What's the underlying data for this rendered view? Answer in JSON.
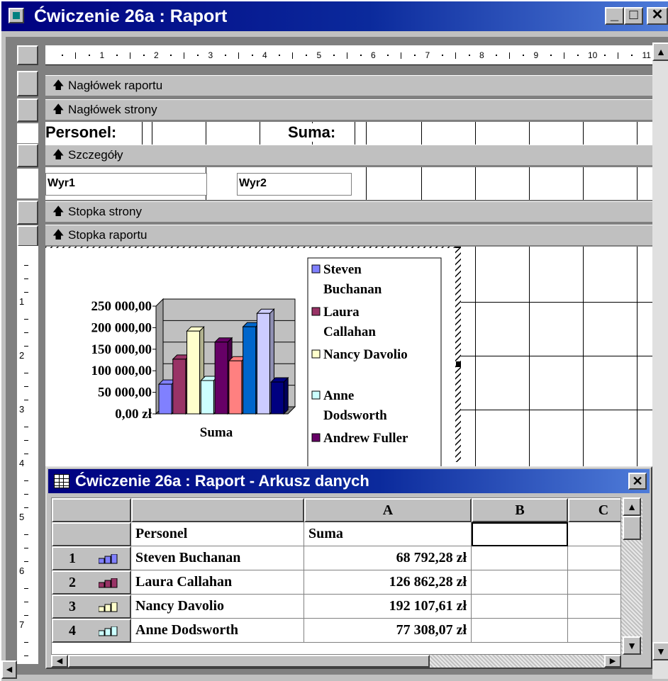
{
  "window": {
    "title": "Ćwiczenie 26a : Raport",
    "min_label": "_",
    "max_label": "□",
    "close_label": "✕"
  },
  "ruler": {
    "ticks": [
      "1",
      "2",
      "3",
      "4",
      "5",
      "6",
      "7",
      "8",
      "9",
      "10",
      "11"
    ],
    "left_ticks": [
      "1",
      "2",
      "3",
      "4",
      "5",
      "6",
      "7"
    ]
  },
  "sections": {
    "report_header": "Nagłówek raportu",
    "page_header": "Nagłówek strony",
    "detail": "Szczegóły",
    "page_footer": "Stopka strony",
    "report_footer": "Stopka raportu",
    "arrow": "🡅"
  },
  "labels": {
    "personel": "Personel:",
    "suma": "Suma:"
  },
  "fields": {
    "wyr1": "Wyr1",
    "wyr2": "Wyr2"
  },
  "chart_data": {
    "type": "bar",
    "title": "",
    "xlabel": "Suma",
    "ylabel": "",
    "categories": [
      "Suma"
    ],
    "yticks": [
      "250 000,00",
      "200 000,00",
      "150 000,00",
      "100 000,00",
      "50 000,00",
      "0,00 zł"
    ],
    "ylim": [
      0,
      250000
    ],
    "series": [
      {
        "name": "Steven Buchanan",
        "value": 68792.28,
        "color": "#8080ff"
      },
      {
        "name": "Laura Callahan",
        "value": 126862.28,
        "color": "#993366"
      },
      {
        "name": "Nancy Davolio",
        "value": 192107.61,
        "color": "#ffffcc"
      },
      {
        "name": "Anne Dodsworth",
        "value": 77308.07,
        "color": "#ccffff"
      },
      {
        "name": "Andrew Fuller",
        "value": 166537.76,
        "color": "#660066"
      },
      {
        "name": "",
        "value": 123032.67,
        "color": "#ff8080"
      },
      {
        "name": "",
        "value": 202143.71,
        "color": "#0066cc"
      },
      {
        "name": "",
        "value": 233147.94,
        "color": "#ccccff"
      },
      {
        "name": "",
        "value": 73913.13,
        "color": "#000080"
      }
    ],
    "legend_items": [
      "Steven",
      "Buchanan",
      "Laura",
      "Callahan",
      "Nancy Davolio",
      "Anne",
      "Dodsworth",
      "Andrew Fuller"
    ],
    "legend": "right",
    "grid": true
  },
  "datasheet": {
    "title": "Ćwiczenie 26a : Raport - Arkusz danych",
    "close_label": "✕",
    "columns": [
      "",
      "A",
      "B",
      "C"
    ],
    "header_row": {
      "personel": "Personel",
      "suma": "Suma"
    },
    "rows": [
      {
        "num": "1",
        "name": "Steven Buchanan",
        "value": "68 792,28 zł",
        "color": "#8080ff"
      },
      {
        "num": "2",
        "name": "Laura Callahan",
        "value": "126 862,28 zł",
        "color": "#993366"
      },
      {
        "num": "3",
        "name": "Nancy Davolio",
        "value": "192 107,61 zł",
        "color": "#ffffcc"
      },
      {
        "num": "4",
        "name": "Anne Dodsworth",
        "value": "77 308,07 zł",
        "color": "#ccffff"
      }
    ]
  }
}
